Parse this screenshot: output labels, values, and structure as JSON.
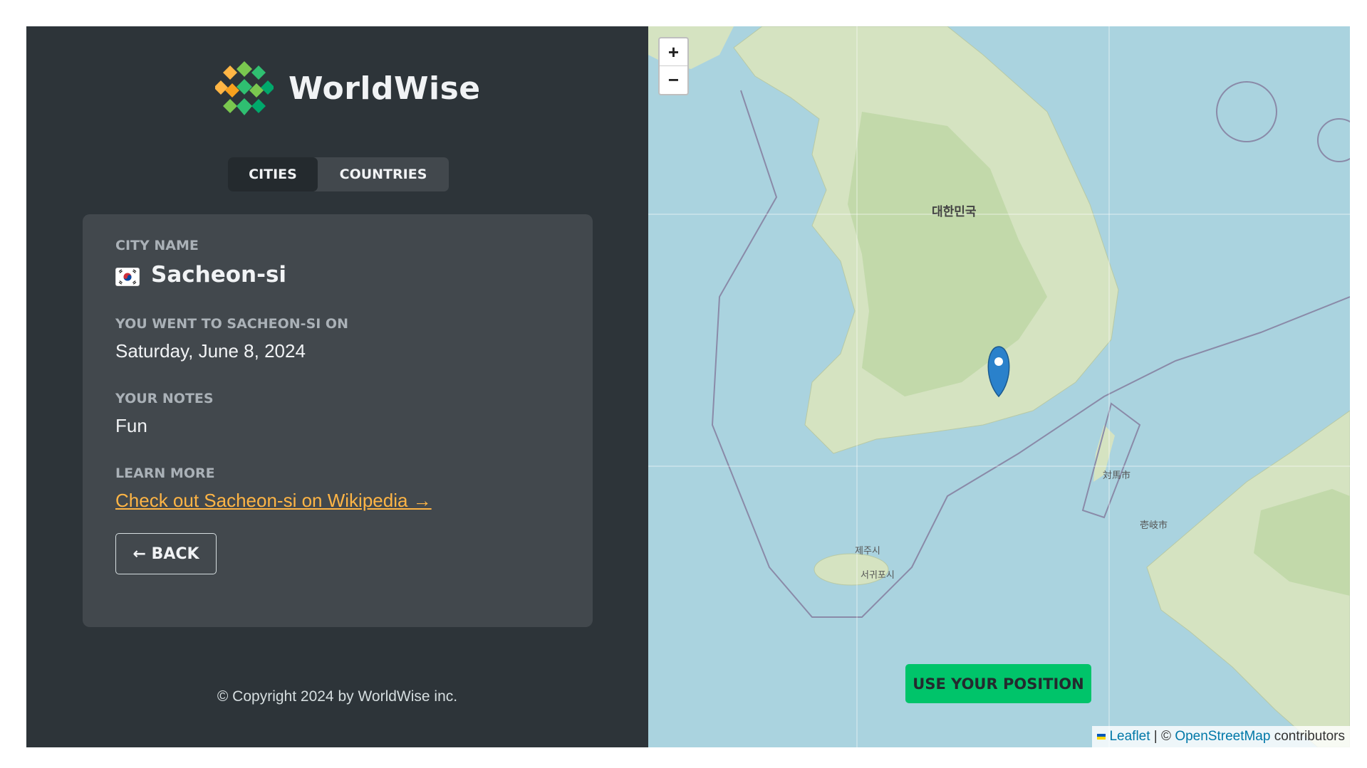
{
  "brand": {
    "name": "WorldWise"
  },
  "tabs": [
    {
      "label": "CITIES",
      "active": true
    },
    {
      "label": "COUNTRIES",
      "active": false
    }
  ],
  "city": {
    "name_label": "CITY NAME",
    "flag_emoji": "🇰🇷",
    "name": "Sacheon-si",
    "visit_label": "YOU WENT TO SACHEON-SI ON",
    "visit_date": "Saturday, June 8, 2024",
    "notes_label": "YOUR NOTES",
    "notes": "Fun",
    "learn_label": "LEARN MORE",
    "wiki_link": "Check out Sacheon-si on Wikipedia →",
    "back_label": "← BACK"
  },
  "footer": {
    "copyright": "© Copyright 2024 by WorldWise inc."
  },
  "map": {
    "zoom_in": "+",
    "zoom_out": "−",
    "use_position": "USE YOUR POSITION",
    "attribution": {
      "leaflet": "Leaflet",
      "separator": " | © ",
      "osm": "OpenStreetMap",
      "contributors": " contributors"
    },
    "country_label": "대한민국",
    "place_labels": [
      "제주시",
      "서귀포시",
      "対馬市",
      "壱岐市"
    ]
  },
  "colors": {
    "sidebar": "#2d3439",
    "card": "#42484d",
    "accent_orange": "#ffb545",
    "accent_green": "#00c46a",
    "sea": "#aad3df"
  }
}
